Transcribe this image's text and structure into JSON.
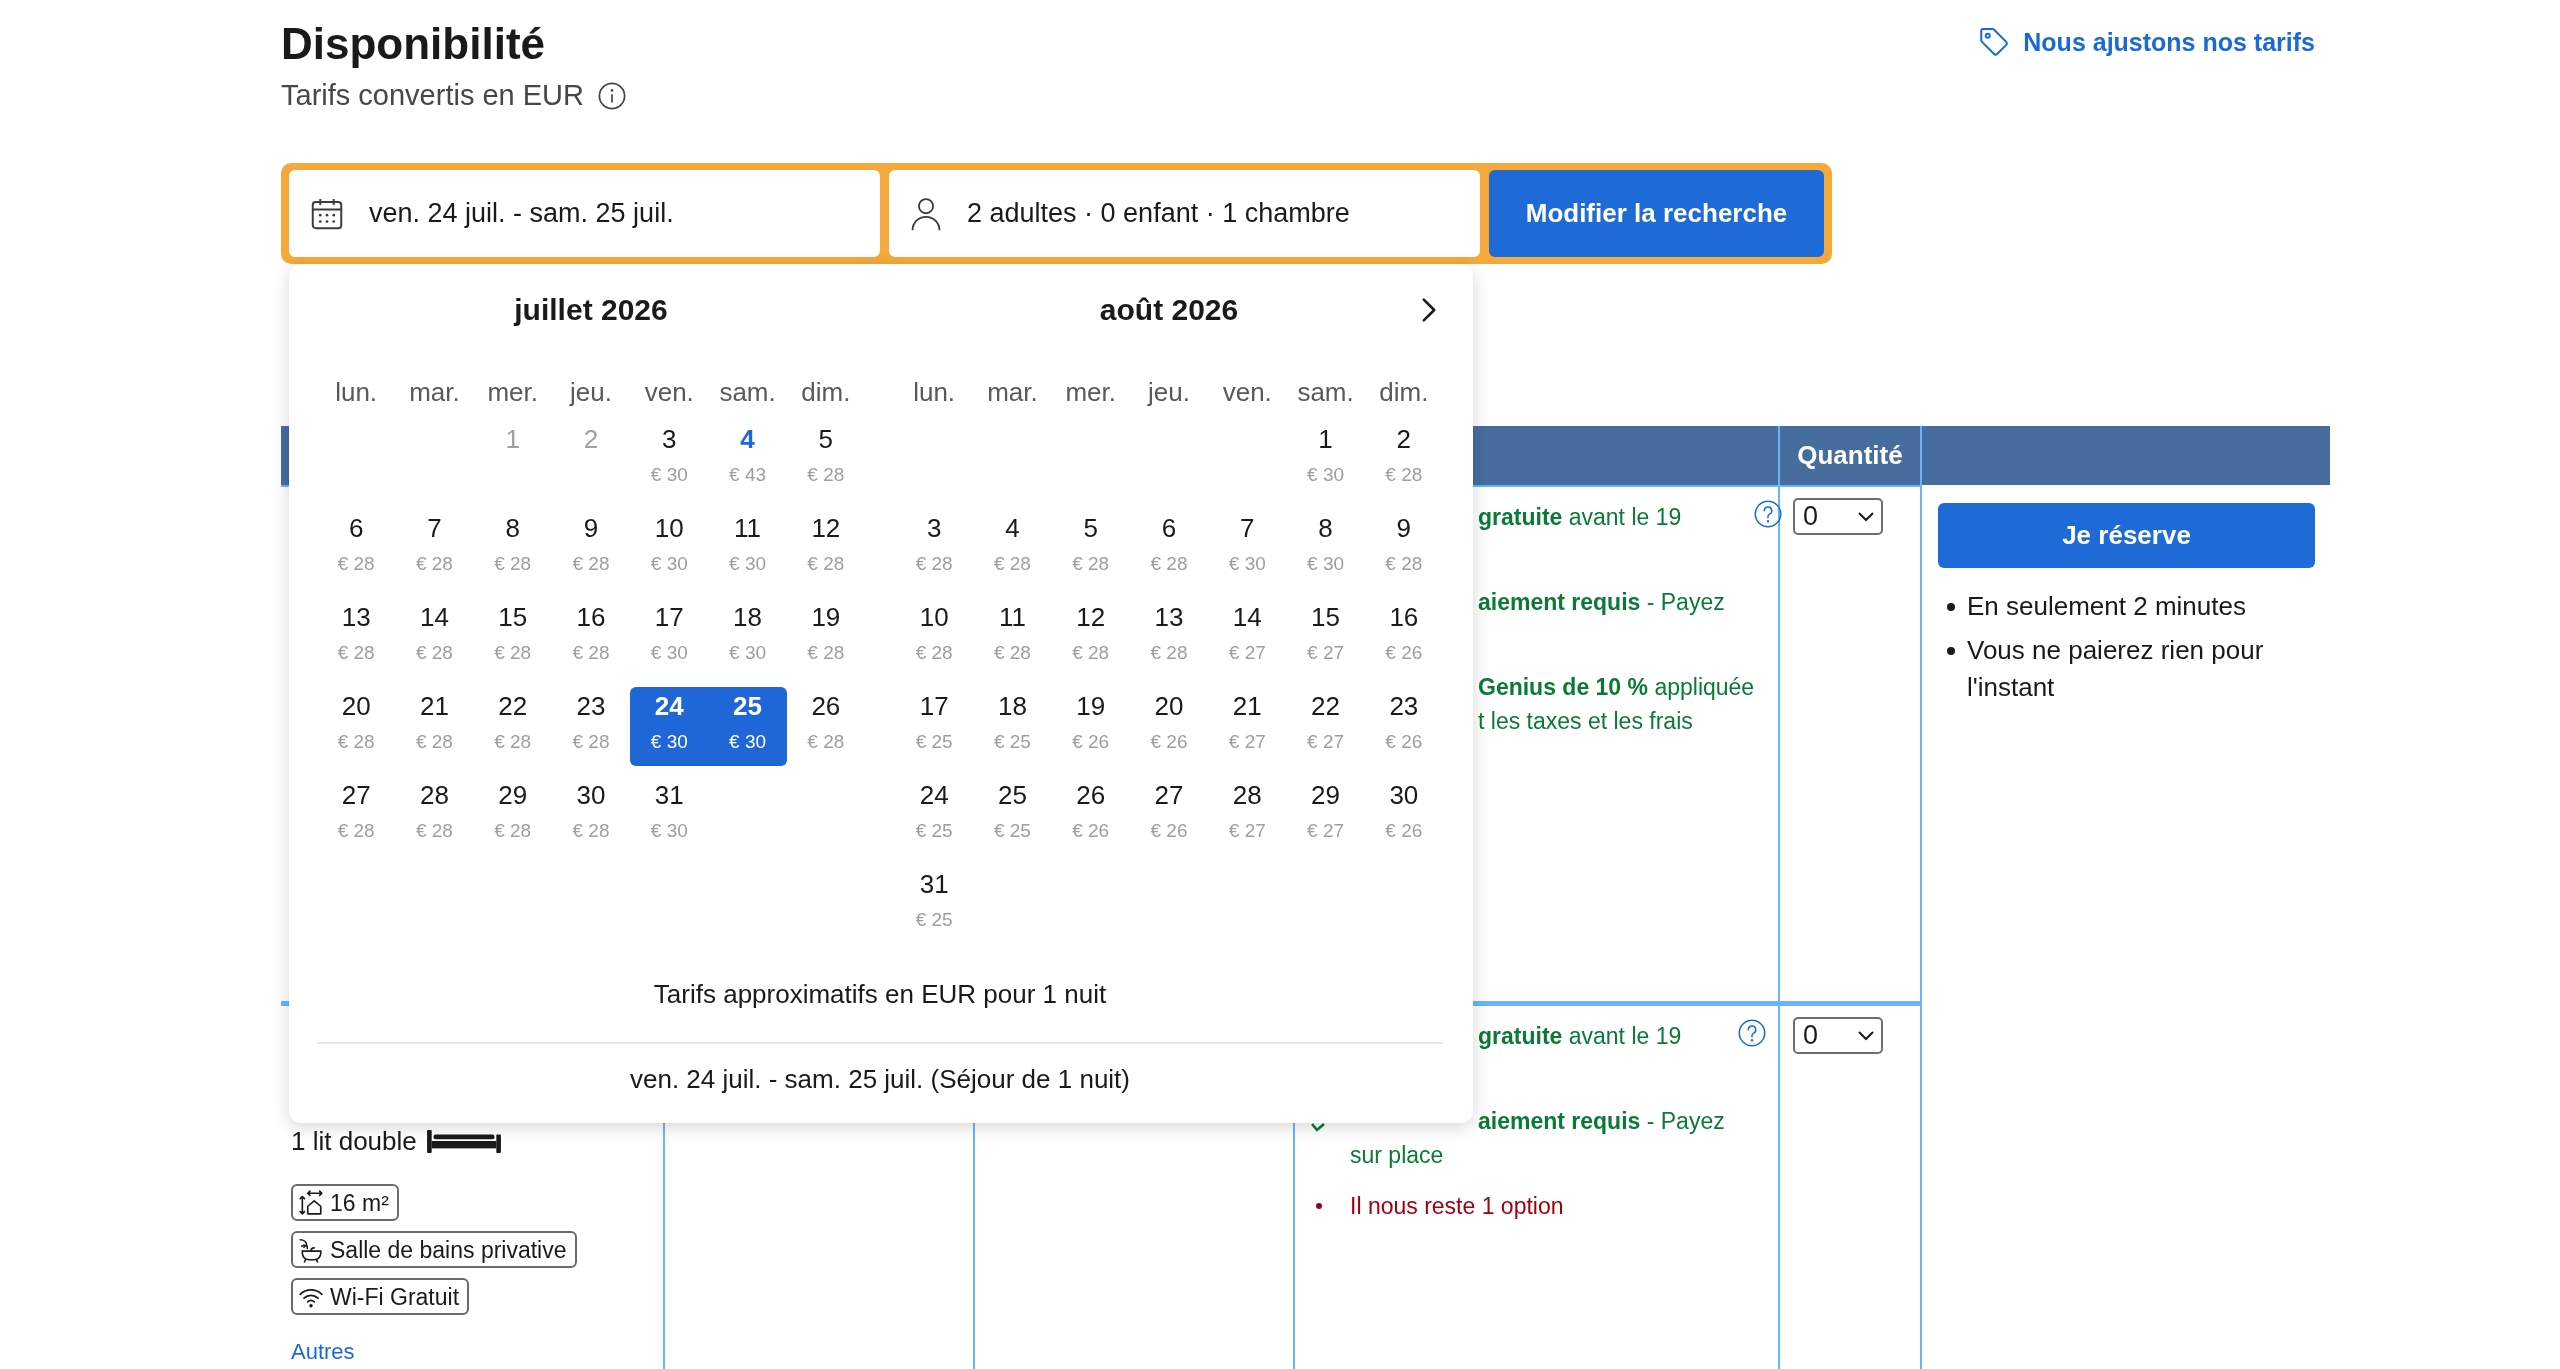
{
  "header": {
    "title": "Disponibilité",
    "subtitle": "Tarifs convertis en EUR",
    "pricing_link": "Nous ajustons nos tarifs"
  },
  "search": {
    "dates": "ven. 24 juil. - sam. 25 juil.",
    "guests": "2 adultes · 0 enfant · 1 chambre",
    "button": "Modifier la recherche"
  },
  "calendar": {
    "months": [
      {
        "title": "juillet 2026",
        "weekdays": [
          "lun.",
          "mar.",
          "mer.",
          "jeu.",
          "ven.",
          "sam.",
          "dim."
        ],
        "weeks": [
          [
            {
              "day": "1",
              "kind": "disabled",
              "selected": false
            },
            {
              "day": "2",
              "kind": "disabled",
              "selected": false
            },
            {
              "day": "3",
              "price": "€ 30",
              "kind": "day",
              "selected": false
            },
            {
              "day": "4",
              "price": "€ 43",
              "kind": "today",
              "selected": false
            },
            {
              "day": "5",
              "price": "€ 28",
              "kind": "day",
              "selected": false
            }
          ],
          [
            {
              "day": "6",
              "price": "€ 28",
              "kind": "day",
              "selected": false
            },
            {
              "day": "7",
              "price": "€ 28",
              "kind": "day",
              "selected": false
            },
            {
              "day": "8",
              "price": "€ 28",
              "kind": "day",
              "selected": false
            },
            {
              "day": "9",
              "price": "€ 28",
              "kind": "day",
              "selected": false
            },
            {
              "day": "10",
              "price": "€ 30",
              "kind": "day",
              "selected": false
            },
            {
              "day": "11",
              "price": "€ 30",
              "kind": "day",
              "selected": false
            },
            {
              "day": "12",
              "price": "€ 28",
              "kind": "day",
              "selected": false
            }
          ],
          [
            {
              "day": "13",
              "price": "€ 28",
              "kind": "day",
              "selected": false
            },
            {
              "day": "14",
              "price": "€ 28",
              "kind": "day",
              "selected": false
            },
            {
              "day": "15",
              "price": "€ 28",
              "kind": "day",
              "selected": false
            },
            {
              "day": "16",
              "price": "€ 28",
              "kind": "day",
              "selected": false
            },
            {
              "day": "17",
              "price": "€ 30",
              "kind": "day",
              "selected": false
            },
            {
              "day": "18",
              "price": "€ 30",
              "kind": "day",
              "selected": false
            },
            {
              "day": "19",
              "price": "€ 28",
              "kind": "day",
              "selected": false
            }
          ],
          [
            {
              "day": "20",
              "price": "€ 28",
              "kind": "day",
              "selected": false
            },
            {
              "day": "21",
              "price": "€ 28",
              "kind": "day",
              "selected": false
            },
            {
              "day": "22",
              "price": "€ 28",
              "kind": "day",
              "selected": false
            },
            {
              "day": "23",
              "price": "€ 28",
              "kind": "day",
              "selected": false
            },
            {
              "day": "24",
              "price": "€ 30",
              "kind": "day",
              "selected": true
            },
            {
              "day": "25",
              "price": "€ 30",
              "kind": "day",
              "selected": true
            },
            {
              "day": "26",
              "price": "€ 28",
              "kind": "day",
              "selected": false
            }
          ],
          [
            {
              "day": "27",
              "price": "€ 28",
              "kind": "day",
              "selected": false
            },
            {
              "day": "28",
              "price": "€ 28",
              "kind": "day",
              "selected": false
            },
            {
              "day": "29",
              "price": "€ 28",
              "kind": "day",
              "selected": false
            },
            {
              "day": "30",
              "price": "€ 28",
              "kind": "day",
              "selected": false
            },
            {
              "day": "31",
              "price": "€ 30",
              "kind": "day",
              "selected": false
            }
          ]
        ]
      },
      {
        "title": "août 2026",
        "weekdays": [
          "lun.",
          "mar.",
          "mer.",
          "jeu.",
          "ven.",
          "sam.",
          "dim."
        ],
        "weeks": [
          [
            {
              "day": "1",
              "price": "€ 30",
              "kind": "day",
              "selected": false
            },
            {
              "day": "2",
              "price": "€ 28",
              "kind": "day",
              "selected": false
            }
          ],
          [
            {
              "day": "3",
              "price": "€ 28",
              "kind": "day",
              "selected": false
            },
            {
              "day": "4",
              "price": "€ 28",
              "kind": "day",
              "selected": false
            },
            {
              "day": "5",
              "price": "€ 28",
              "kind": "day",
              "selected": false
            },
            {
              "day": "6",
              "price": "€ 28",
              "kind": "day",
              "selected": false
            },
            {
              "day": "7",
              "price": "€ 30",
              "kind": "day",
              "selected": false
            },
            {
              "day": "8",
              "price": "€ 30",
              "kind": "day",
              "selected": false
            },
            {
              "day": "9",
              "price": "€ 28",
              "kind": "day",
              "selected": false
            }
          ],
          [
            {
              "day": "10",
              "price": "€ 28",
              "kind": "day",
              "selected": false
            },
            {
              "day": "11",
              "price": "€ 28",
              "kind": "day",
              "selected": false
            },
            {
              "day": "12",
              "price": "€ 28",
              "kind": "day",
              "selected": false
            },
            {
              "day": "13",
              "price": "€ 28",
              "kind": "day",
              "selected": false
            },
            {
              "day": "14",
              "price": "€ 27",
              "kind": "day",
              "selected": false
            },
            {
              "day": "15",
              "price": "€ 27",
              "kind": "day",
              "selected": false
            },
            {
              "day": "16",
              "price": "€ 26",
              "kind": "day",
              "selected": false
            }
          ],
          [
            {
              "day": "17",
              "price": "€ 25",
              "kind": "day",
              "selected": false
            },
            {
              "day": "18",
              "price": "€ 25",
              "kind": "day",
              "selected": false
            },
            {
              "day": "19",
              "price": "€ 26",
              "kind": "day",
              "selected": false
            },
            {
              "day": "20",
              "price": "€ 26",
              "kind": "day",
              "selected": false
            },
            {
              "day": "21",
              "price": "€ 27",
              "kind": "day",
              "selected": false
            },
            {
              "day": "22",
              "price": "€ 27",
              "kind": "day",
              "selected": false
            },
            {
              "day": "23",
              "price": "€ 26",
              "kind": "day",
              "selected": false
            }
          ],
          [
            {
              "day": "24",
              "price": "€ 25",
              "kind": "day",
              "selected": false
            },
            {
              "day": "25",
              "price": "€ 25",
              "kind": "day",
              "selected": false
            },
            {
              "day": "26",
              "price": "€ 26",
              "kind": "day",
              "selected": false
            },
            {
              "day": "27",
              "price": "€ 26",
              "kind": "day",
              "selected": false
            },
            {
              "day": "28",
              "price": "€ 27",
              "kind": "day",
              "selected": false
            },
            {
              "day": "29",
              "price": "€ 27",
              "kind": "day",
              "selected": false
            },
            {
              "day": "30",
              "price": "€ 26",
              "kind": "day",
              "selected": false
            }
          ],
          [
            {
              "day": "31",
              "price": "€ 25",
              "kind": "day",
              "selected": false
            }
          ]
        ]
      }
    ],
    "note": "Tarifs approximatifs en EUR pour 1 nuit",
    "summary": "ven. 24 juil. - sam. 25 juil. (Séjour de 1 nuit)"
  },
  "table": {
    "quantity_header": "Quantité",
    "rows": [
      {
        "conditions": [
          {
            "kind": "perk",
            "check": false,
            "lines": [
              {
                "kind": "clipped",
                "text": "**gratuite** avant le 19"
              }
            ]
          },
          {
            "kind": "perk",
            "check": false,
            "lines": [
              {
                "kind": "clipped",
                "text": "**aiement requis** - Payez"
              }
            ]
          },
          {
            "kind": "perk",
            "check": false,
            "lines": [
              {
                "kind": "clipped",
                "text": "**Genius de 10 %** appliquée"
              },
              {
                "kind": "clipped",
                "text": "t les taxes et les frais"
              }
            ]
          }
        ],
        "quantity": "0"
      },
      {
        "room": {
          "beds": "1 lit double",
          "facilities": [
            {
              "kind": "size",
              "label": "16 m²"
            },
            {
              "kind": "bathroom",
              "label": "Salle de bains privative"
            },
            {
              "kind": "wifi",
              "label": "Wi-Fi Gratuit"
            }
          ],
          "more_link": "Autres"
        },
        "conditions": [
          {
            "kind": "perk",
            "check": false,
            "lines": [
              {
                "kind": "clipped",
                "text": "**gratuite** avant le 19"
              }
            ]
          },
          {
            "kind": "perk",
            "check": true,
            "lines": [
              {
                "kind": "clipped",
                "text": "**aiement requis** - Payez"
              },
              {
                "kind": "whole",
                "text": "sur place"
              }
            ]
          },
          {
            "kind": "warning",
            "check": false,
            "lines": [
              {
                "kind": "whole",
                "text": "Il nous reste 1 option"
              }
            ]
          }
        ],
        "quantity": "0"
      }
    ]
  },
  "reserve": {
    "button": "Je réserve",
    "bullets": [
      "En seulement 2 minutes",
      "Vous ne paierez rien pour l'instant"
    ]
  }
}
